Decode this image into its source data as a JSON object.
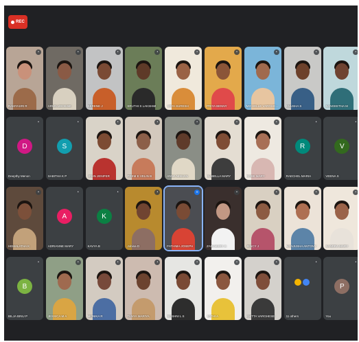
{
  "toolbar": {
    "rec_label": "REC"
  },
  "tiles": [
    {
      "name": "RAMYASRI R",
      "kind": "video",
      "bg": "#b8a596",
      "skin": "#c9917a",
      "shirt": "#9c6b4a"
    },
    {
      "name": "ARUN LEKSHMI",
      "kind": "video",
      "bg": "#6f6a63",
      "skin": "#8a5a45",
      "shirt": "#d8d0c0"
    },
    {
      "name": "SERENE J",
      "kind": "video",
      "bg": "#c2c3c4",
      "skin": "#7a4a34",
      "shirt": "#c85f2a"
    },
    {
      "name": "SRUTHI S LAKSHMI",
      "kind": "video",
      "bg": "#6b7d58",
      "skin": "#5e3a28",
      "shirt": "#2a2a2a"
    },
    {
      "name": "ARYA SURESH",
      "kind": "video",
      "bg": "#f0e9dc",
      "skin": "#9a6245",
      "shirt": "#d98d3a"
    },
    {
      "name": "PRIYA BENNY",
      "kind": "video",
      "bg": "#e3a94b",
      "skin": "#8b5538",
      "shirt": "#e04a4a"
    },
    {
      "name": "MICHELLE VARGHESE",
      "kind": "video",
      "bg": "#7bb5d9",
      "skin": "#a06a4e",
      "shirt": "#e7c5a0"
    },
    {
      "name": "ANUSHA S",
      "kind": "video",
      "bg": "#c9c9c7",
      "skin": "#6d412b",
      "shirt": "#385f86"
    },
    {
      "name": "SANGEETHA M",
      "kind": "video",
      "bg": "#bfd8dc",
      "skin": "#6f4331",
      "shirt": "#2f6e78"
    },
    {
      "name": "Deepthy Menon",
      "kind": "avatar",
      "initial": "D",
      "color": "#d01884"
    },
    {
      "name": "SABITHA K P",
      "kind": "avatar",
      "initial": "S",
      "color": "#129eaf"
    },
    {
      "name": "JOHN JENIFER",
      "kind": "video",
      "bg": "#d9d3c8",
      "skin": "#7c4b33",
      "shirt": "#b9332f"
    },
    {
      "name": "PREM E VELIN B",
      "kind": "video",
      "bg": "#d3c9bd",
      "skin": "#8c5f49",
      "shirt": "#c77b5b"
    },
    {
      "name": "ANNA NISHAN",
      "kind": "video",
      "bg": "#8a8e86",
      "skin": "#5f3b2a",
      "shirt": "#e0d8c6"
    },
    {
      "name": "ISABELLA MARY",
      "kind": "video",
      "bg": "#e4ddd2",
      "skin": "#7f4d35",
      "shirt": "#3d3d3d"
    },
    {
      "name": "ROSE MARY",
      "kind": "video",
      "bg": "#eee9e1",
      "skin": "#a86f56",
      "shirt": "#d8b7b2"
    },
    {
      "name": "RAECHEL MARIA",
      "kind": "avatar",
      "initial": "R",
      "color": "#00897b"
    },
    {
      "name": "VEENA S",
      "kind": "avatar",
      "initial": "V",
      "color": "#33691e"
    },
    {
      "name": "HEMALATHA K",
      "kind": "video",
      "bg": "#5e4a3c",
      "skin": "#7c503a",
      "shirt": "#c2a17a"
    },
    {
      "name": "ADRIANNE MARY",
      "kind": "avatar",
      "initial": "A",
      "color": "#e91e63"
    },
    {
      "name": "KAVYA B",
      "kind": "avatar",
      "initial": "K",
      "color": "#0b8043"
    },
    {
      "name": "Jobina D",
      "kind": "video",
      "bg": "#b88a2e",
      "skin": "#704431",
      "shirt": "#8d6e63"
    },
    {
      "name": "FATHIMA JOSEPH",
      "kind": "video",
      "bg": "#4b4d52",
      "skin": "#7a4b35",
      "shirt": "#d84334",
      "active": true
    },
    {
      "name": "ZAIN MARY S",
      "kind": "video",
      "bg": "#3a2f2d",
      "skin": "#c29884",
      "shirt": "#f2f2f2"
    },
    {
      "name": "JENCY J",
      "kind": "video",
      "bg": "#d9d0c2",
      "skin": "#8c5b42",
      "shirt": "#b6546b"
    },
    {
      "name": "MANJUSHA ANTONY",
      "kind": "video",
      "bg": "#ece3d8",
      "skin": "#ae6f52",
      "shirt": "#5c84a8"
    },
    {
      "name": "SANDRA MARY",
      "kind": "video",
      "bg": "#efe7dc",
      "skin": "#9b6349",
      "shirt": "#e8e2da"
    },
    {
      "name": "BILJA BINU P",
      "kind": "avatar",
      "initial": "B",
      "color": "#7cb342"
    },
    {
      "name": "JESSICA M A",
      "kind": "video",
      "bg": "#8f9f86",
      "skin": "#9f6a4f",
      "shirt": "#d9a544"
    },
    {
      "name": "MONIKA R",
      "kind": "video",
      "bg": "#d3cbc1",
      "skin": "#77493a",
      "shirt": "#4c6ea3"
    },
    {
      "name": "TANYA MARIYA",
      "kind": "video",
      "bg": "#cdbbb0",
      "skin": "#6c432f",
      "shirt": "#c49b6d"
    },
    {
      "name": "ROSHNI L S",
      "kind": "video",
      "bg": "#e6e6e3",
      "skin": "#7a4a35",
      "shirt": "#2d2d2d"
    },
    {
      "name": "JOTHI A",
      "kind": "video",
      "bg": "#f2f0ed",
      "skin": "#8b573f",
      "shirt": "#e8c23a"
    },
    {
      "name": "ANITTA VARGHESE",
      "kind": "video",
      "bg": "#d4d1cc",
      "skin": "#7f4e3a",
      "shirt": "#3a3a3a"
    },
    {
      "name": "11 others",
      "kind": "others",
      "colors": [
        "#f4b400",
        "#4285f4"
      ]
    },
    {
      "name": "You",
      "kind": "avatar",
      "initial": "P",
      "color": "#8d6e63"
    }
  ]
}
